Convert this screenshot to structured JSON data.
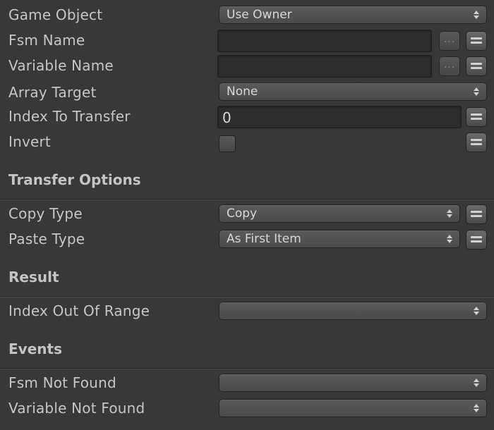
{
  "fields": {
    "game_object": {
      "label": "Game Object",
      "value": "Use Owner"
    },
    "fsm_name": {
      "label": "Fsm Name",
      "value": ""
    },
    "variable_name": {
      "label": "Variable Name",
      "value": ""
    },
    "array_target": {
      "label": "Array Target",
      "value": "None"
    },
    "index_to_transfer": {
      "label": "Index To Transfer",
      "value": "0"
    },
    "invert": {
      "label": "Invert",
      "checked": false
    }
  },
  "transfer_options": {
    "title": "Transfer Options",
    "copy_type": {
      "label": "Copy Type",
      "value": "Copy"
    },
    "paste_type": {
      "label": "Paste Type",
      "value": "As First Item"
    }
  },
  "result": {
    "title": "Result",
    "index_out_of_range": {
      "label": "Index Out Of Range",
      "value": ""
    }
  },
  "events": {
    "title": "Events",
    "fsm_not_found": {
      "label": "Fsm Not Found",
      "value": ""
    },
    "variable_not_found": {
      "label": "Variable Not Found",
      "value": ""
    }
  },
  "icons": {
    "dots": "...",
    "variable_toggle": "equals-icon",
    "dropdown_arrows": "updown-arrows-icon"
  }
}
